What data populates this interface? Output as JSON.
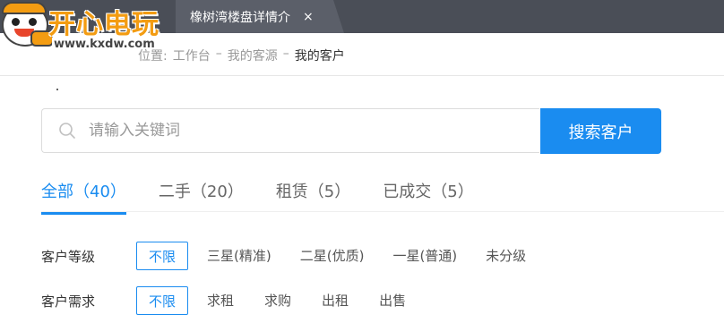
{
  "logo": {
    "brand_text": "开心电玩",
    "url_text": "www.kxdw.com"
  },
  "topbar": {
    "tab_title": "橡树湾楼盘详情介",
    "tab_close": "×"
  },
  "breadcrumb": {
    "prefix": "位置:",
    "items": [
      "工作台",
      "我的客源"
    ],
    "current": "我的客户",
    "separator": "–"
  },
  "search": {
    "placeholder": "请输入关键词",
    "button_label": "搜索客户"
  },
  "tabs": [
    {
      "label": "全部（40）",
      "active": true
    },
    {
      "label": "二手（20）",
      "active": false
    },
    {
      "label": "租赁（5）",
      "active": false
    },
    {
      "label": "已成交（5）",
      "active": false
    }
  ],
  "filters": {
    "level": {
      "label": "客户等级",
      "options": [
        "不限",
        "三星(精准)",
        "二星(优质)",
        "一星(普通)",
        "未分级"
      ],
      "selected": "不限"
    },
    "demand": {
      "label": "客户需求",
      "options": [
        "不限",
        "求租",
        "求购",
        "出租",
        "出售"
      ],
      "selected": "不限"
    }
  },
  "colors": {
    "accent": "#1a8cf0",
    "topbar": "#4a4e57",
    "logo_orange": "#f39c12"
  }
}
